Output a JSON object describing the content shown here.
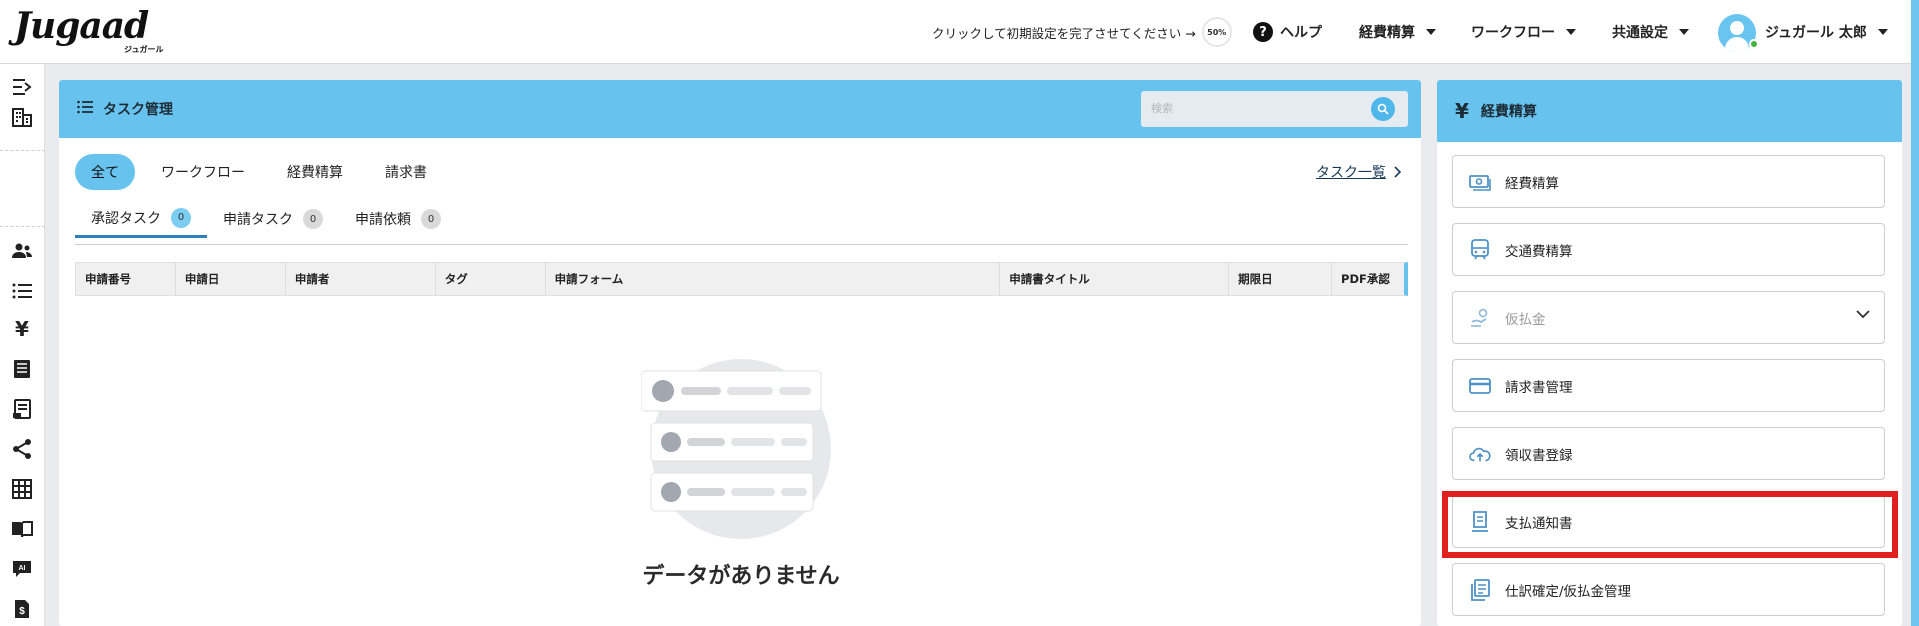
{
  "header": {
    "logo_text": "Jugaad",
    "logo_sub": "ジュガール",
    "setup_text": "クリックして初期設定を完了させてください →",
    "setup_progress": "50%",
    "help_label": "ヘルプ",
    "menu_expense": "経費精算",
    "menu_workflow": "ワークフロー",
    "menu_common": "共通設定",
    "user_name": "ジュガール 太郎"
  },
  "task_panel": {
    "title": "タスク管理",
    "search_placeholder": "検索",
    "filters": [
      "全て",
      "ワークフロー",
      "経費精算",
      "請求書"
    ],
    "active_filter": "全て",
    "task_list_link": "タスク一覧",
    "subtabs": [
      {
        "label": "承認タスク",
        "count": "0"
      },
      {
        "label": "申請タスク",
        "count": "0"
      },
      {
        "label": "申請依頼",
        "count": "0"
      }
    ],
    "columns": [
      "申請番号",
      "申請日",
      "申請者",
      "タグ",
      "申請フォーム",
      "申請書タイトル",
      "期限日",
      "PDF承認"
    ],
    "empty_message": "データがありません"
  },
  "expense_panel": {
    "title": "経費精算",
    "title_icon": "yen-icon",
    "items": [
      {
        "label": "経費精算",
        "icon": "cash-icon"
      },
      {
        "label": "交通費精算",
        "icon": "train-icon"
      },
      {
        "label": "仮払金",
        "icon": "advance-payment-icon",
        "expandable": true
      },
      {
        "label": "請求書管理",
        "icon": "card-icon"
      },
      {
        "label": "領収書登録",
        "icon": "cloud-upload-icon"
      },
      {
        "label": "支払通知書",
        "icon": "receipt-icon",
        "highlighted": true
      },
      {
        "label": "仕訳確定/仮払金管理",
        "icon": "journal-icon"
      }
    ]
  },
  "colors": {
    "accent": "#67c3ee",
    "highlight": "#e0201f",
    "online": "#43b53d"
  }
}
